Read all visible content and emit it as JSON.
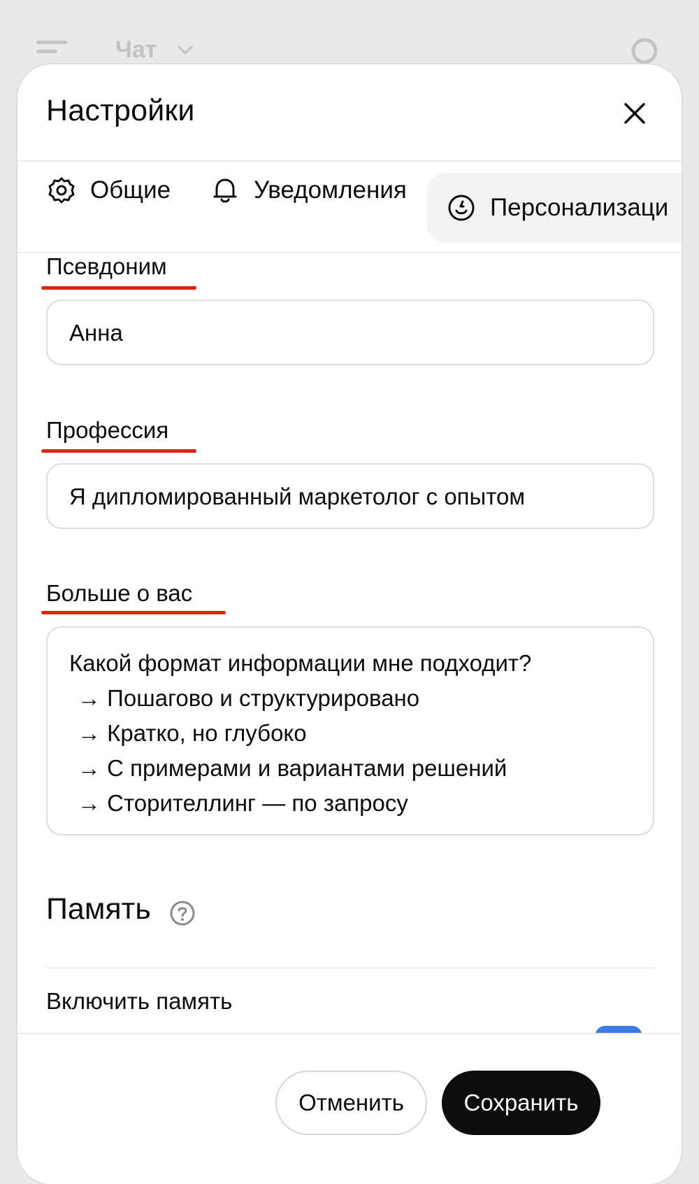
{
  "background": {
    "chat_title": "Чат"
  },
  "modal": {
    "title": "Настройки",
    "tabs": [
      {
        "label": "Общие",
        "icon": "gear-icon"
      },
      {
        "label": "Уведомления",
        "icon": "bell-icon"
      },
      {
        "label": "Персонализаци",
        "icon": "smile-icon",
        "active": true
      }
    ],
    "fields": {
      "nickname": {
        "label": "Псевдоним",
        "value": "Анна"
      },
      "profession": {
        "label": "Профессия",
        "value": "Я дипломированный маркетолог с опытом"
      },
      "about": {
        "label": "Больше о вас",
        "lines": [
          "Какой формат информации мне подходит?",
          " → Пошагово и структурировано",
          " → Кратко, но глубоко",
          " → С примерами и вариантами решений",
          " → Сторителлинг — по запросу"
        ]
      }
    },
    "memory": {
      "title": "Память",
      "enable_label": "Включить память",
      "toggle_on": true
    },
    "buttons": {
      "cancel": "Отменить",
      "save": "Сохранить"
    }
  },
  "colors": {
    "underline": "#d8250c",
    "primary_button": "#0d0d0d",
    "toggle": "#3d7be6"
  }
}
